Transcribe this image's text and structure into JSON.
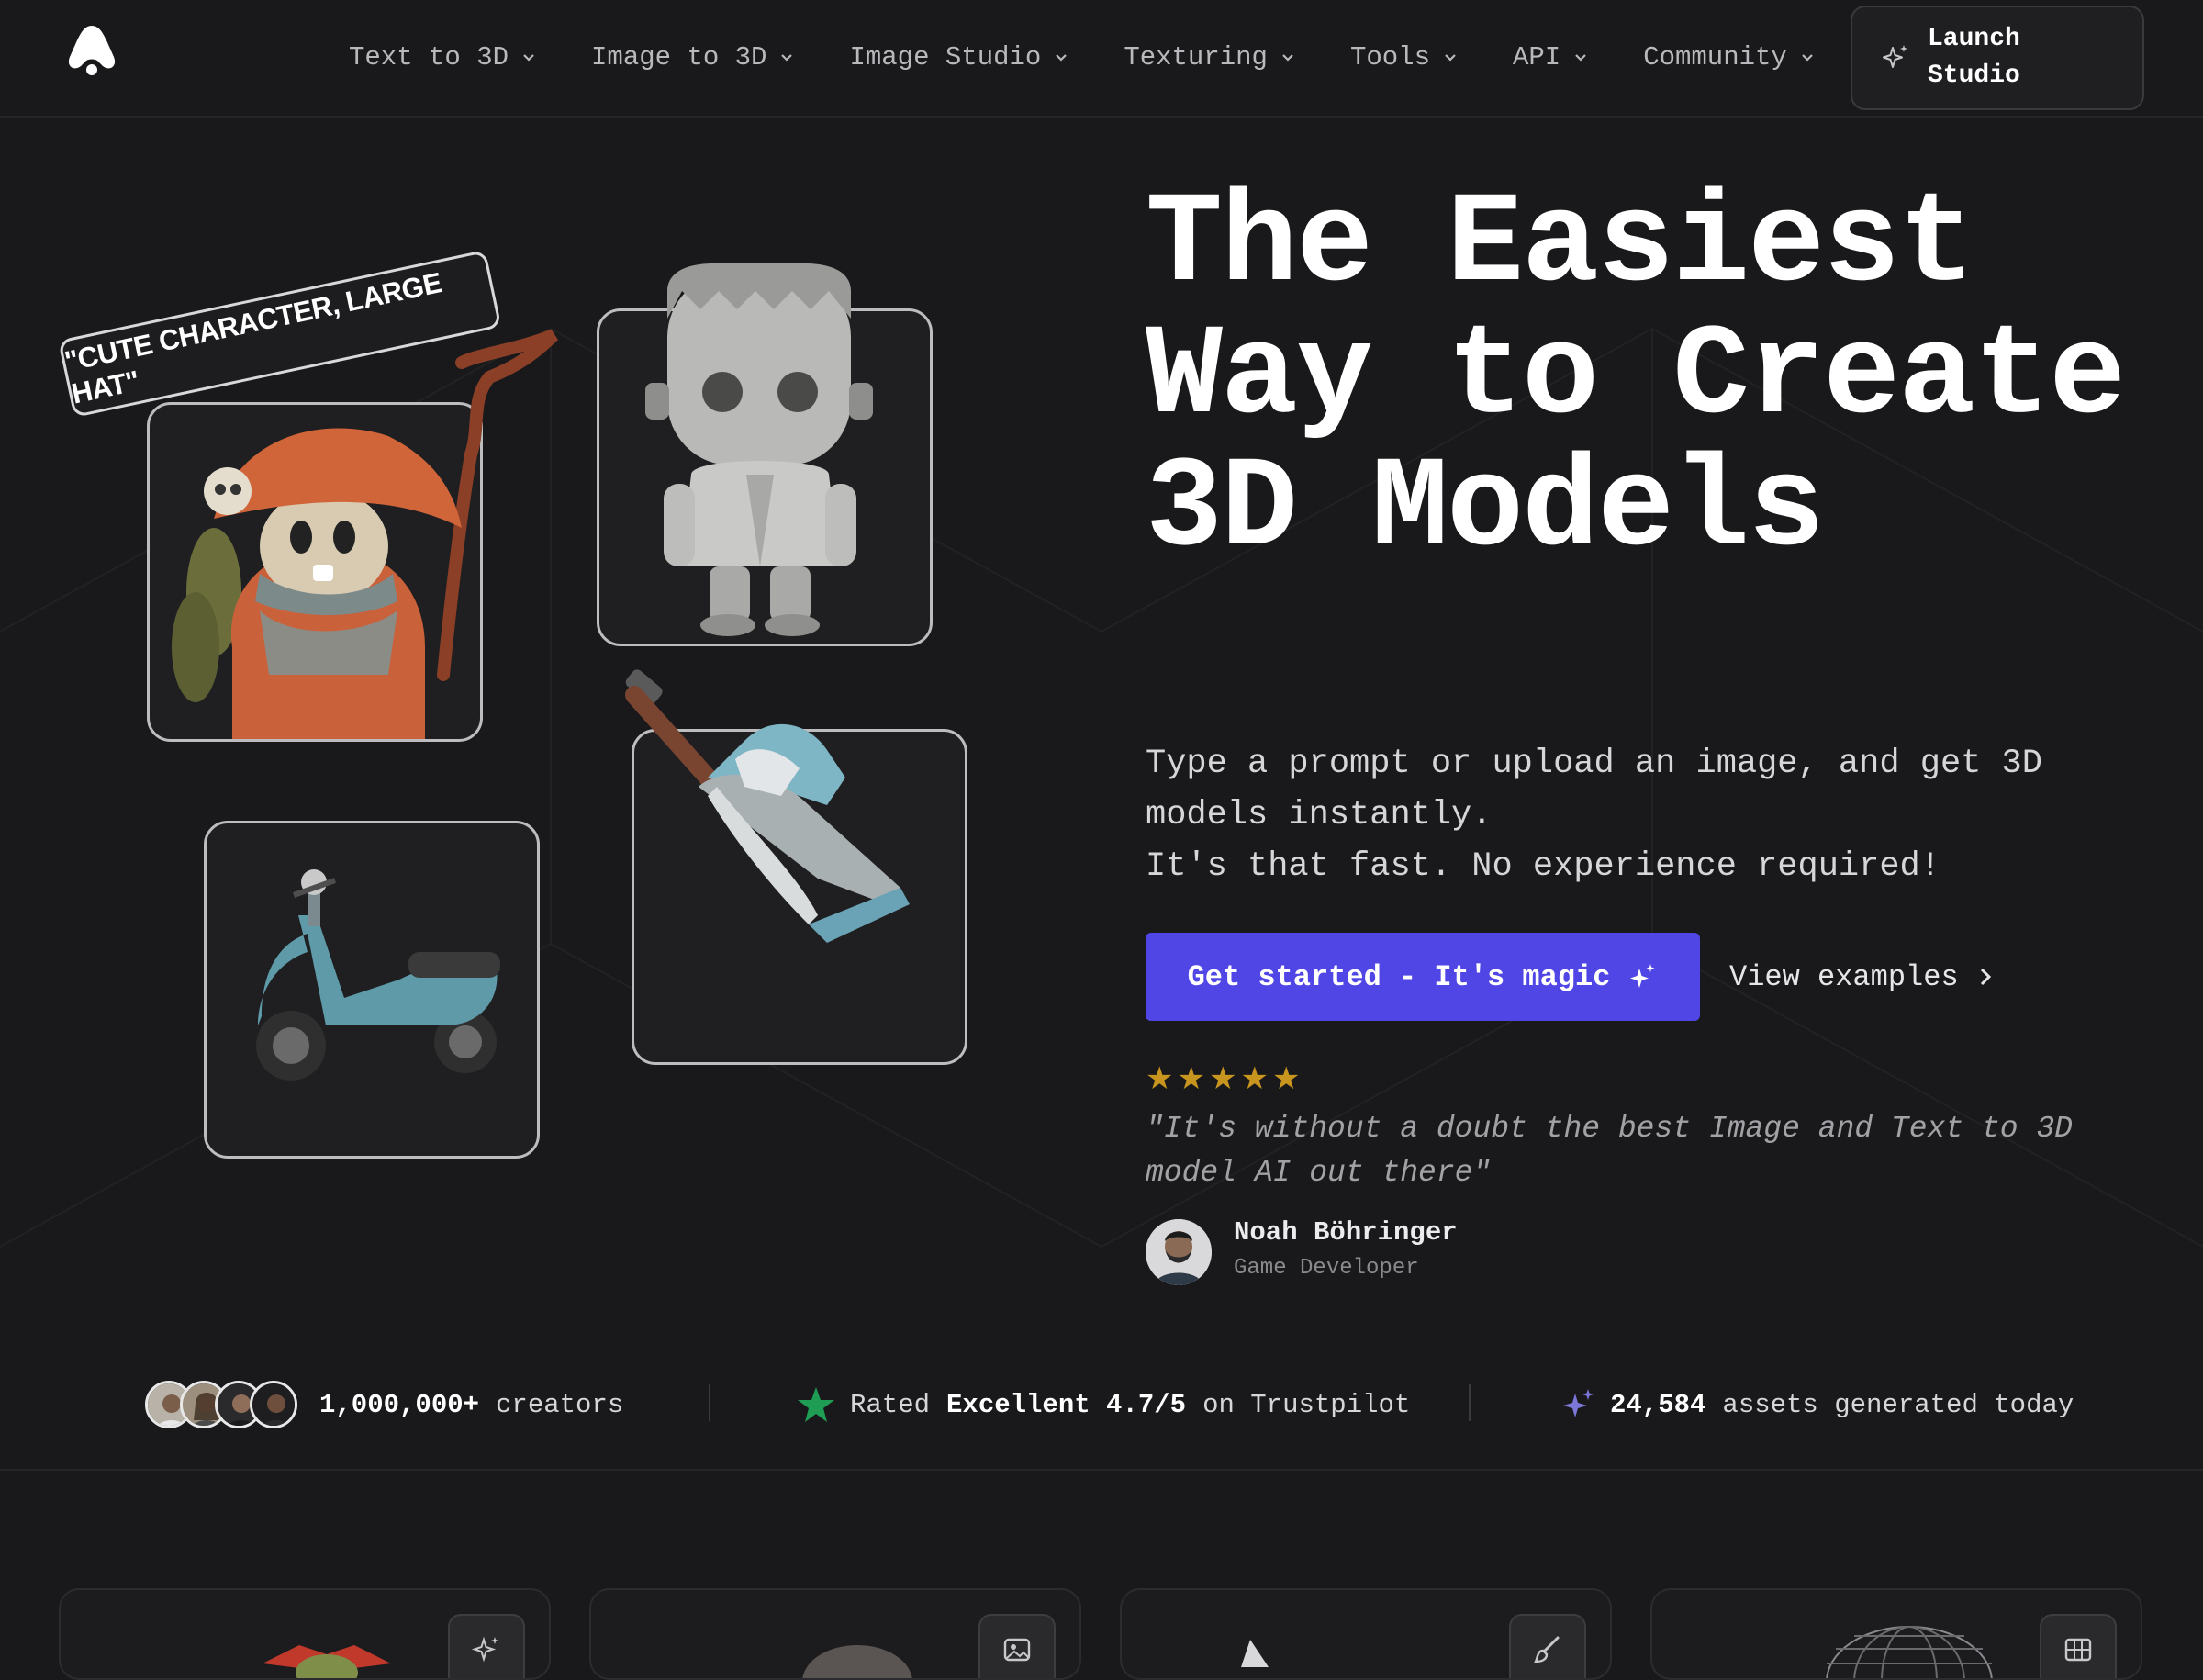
{
  "nav": {
    "items": [
      {
        "label": "Text to 3D"
      },
      {
        "label": "Image to 3D"
      },
      {
        "label": "Image Studio"
      },
      {
        "label": "Texturing"
      },
      {
        "label": "Tools"
      },
      {
        "label": "API"
      },
      {
        "label": "Community"
      }
    ],
    "launch_label": "Launch Studio"
  },
  "hero": {
    "prompt_tag": "\"CUTE CHARACTER, LARGE HAT\"",
    "headline": "The Easiest Way to Create 3D Models",
    "sub_line1": "Type a prompt or upload an image, and get 3D models instantly.",
    "sub_line2": "It's that fast. No experience required!",
    "cta_label": "Get started - It's magic",
    "view_examples_label": "View examples",
    "rating_stars": 5,
    "quote": "\"It's without a doubt the best Image and Text to 3D model AI out there\"",
    "author_name": "Noah Böhringer",
    "author_role": "Game Developer"
  },
  "stats": {
    "creators_value": "1,000,000+",
    "creators_label": "creators",
    "rated_prefix": "Rated",
    "rated_value": "Excellent 4.7/5",
    "rated_suffix": "on Trustpilot",
    "assets_value": "24,584",
    "assets_label": "assets generated today"
  },
  "colors": {
    "background": "#19191b",
    "accent": "#4f46e5",
    "star": "#c8961e",
    "trustpilot": "#1f9d55"
  },
  "feature_icons": [
    "sparkle-icon",
    "image-icon",
    "brush-icon",
    "grid-icon"
  ]
}
